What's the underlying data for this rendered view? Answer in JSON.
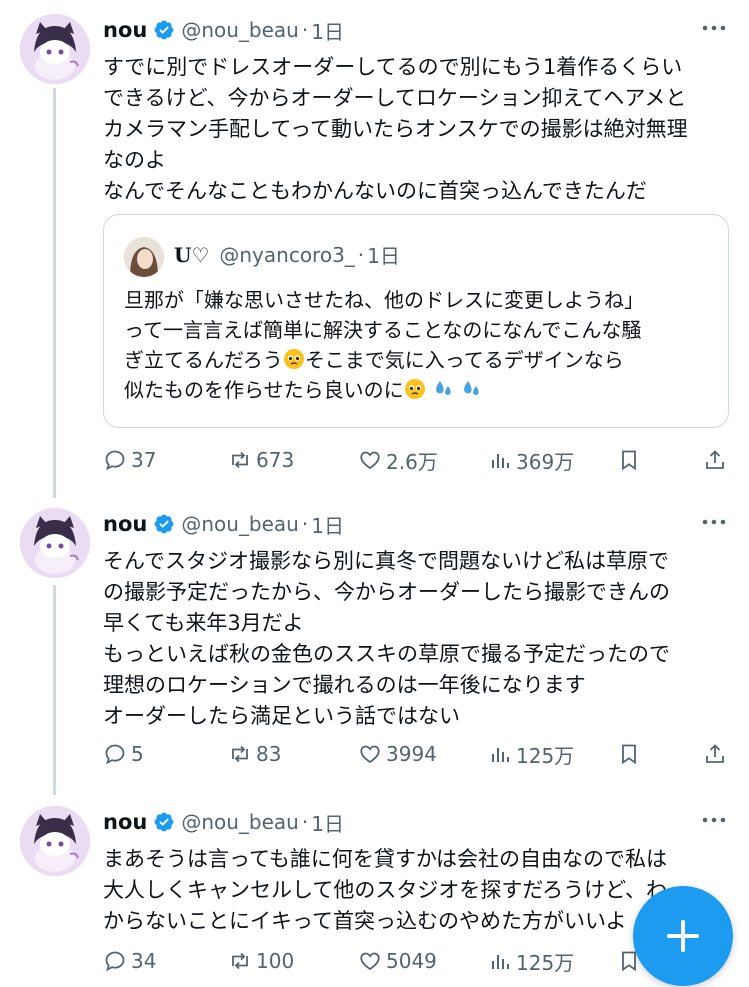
{
  "colors": {
    "accent": "#1d9bf0",
    "secondary_text": "#536471",
    "border": "#cfd9de"
  },
  "tweets": [
    {
      "name": "nou",
      "handle": "@nou_beau",
      "separator": "·",
      "time": "1日",
      "text": "すでに別でドレスオーダーしてるので別にもう1着作るくらい\nできるけど、今からオーダーしてロケーション抑えてヘアメと\nカメラマン手配してって動いたらオンスケでの撮影は絶対無理\nなのよ\nなんでそんなこともわかんないのに首突っ込んできたんだ",
      "quote": {
        "name": "U♡",
        "handle": "@nyancoro3_",
        "separator": "·",
        "time": "1日",
        "text_before": "旦那が「嫌な思いさせたね、他のドレスに変更しようね」\nって一言言えば簡単に解決することなのになんでこんな騒\nぎ立てるんだろう",
        "text_middle": "そこまで気に入ってるデザインなら\n似たものを作らせたら良いのに",
        "emoji_1": "pleading-face",
        "emoji_2": "sweat-droplets"
      },
      "replies": "37",
      "retweets": "673",
      "likes": "2.6万",
      "views": "369万"
    },
    {
      "name": "nou",
      "handle": "@nou_beau",
      "separator": "·",
      "time": "1日",
      "text": "そんでスタジオ撮影なら別に真冬で問題ないけど私は草原で\nの撮影予定だったから、今からオーダーしたら撮影できんの\n早くても来年3月だよ\nもっといえば秋の金色のススキの草原で撮る予定だったので\n理想のロケーションで撮れるのは一年後になります\nオーダーしたら満足という話ではない",
      "replies": "5",
      "retweets": "83",
      "likes": "3994",
      "views": "125万"
    },
    {
      "name": "nou",
      "handle": "@nou_beau",
      "separator": "·",
      "time": "1日",
      "text": "まあそうは言っても誰に何を貸すかは会社の自由なので私は\n大人しくキャンセルして他のスタジオを探すだろうけど、わ\nからないことにイキって首突っ込むのやめた方がいいよ",
      "replies": "34",
      "retweets": "100",
      "likes": "5049",
      "views": "125万"
    }
  ],
  "icons": {
    "reply": "reply-icon",
    "retweet": "retweet-icon",
    "like": "heart-icon",
    "views": "views-icon",
    "bookmark": "bookmark-icon",
    "share": "share-icon",
    "verified": "verified-badge-icon",
    "more": "more-icon",
    "compose": "compose-plus-icon"
  }
}
